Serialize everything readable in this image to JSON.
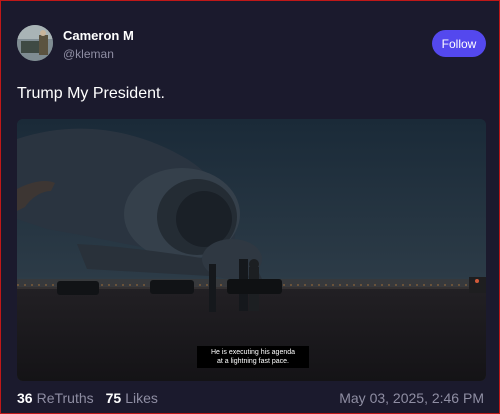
{
  "author": {
    "name": "Cameron M",
    "handle": "@kleman"
  },
  "follow_label": "Follow",
  "post_text": "Trump My President.",
  "media": {
    "caption_line1": "He is executing his agenda",
    "caption_line2": "at a lightning fast pace."
  },
  "stats": {
    "retruths_count": "36",
    "retruths_label": "ReTruths",
    "likes_count": "75",
    "likes_label": "Likes"
  },
  "timestamp": "May 03, 2025, 2:46 PM",
  "colors": {
    "background": "#1b1a2d",
    "accent": "#5448ee",
    "muted_text": "#8f8ea3"
  }
}
